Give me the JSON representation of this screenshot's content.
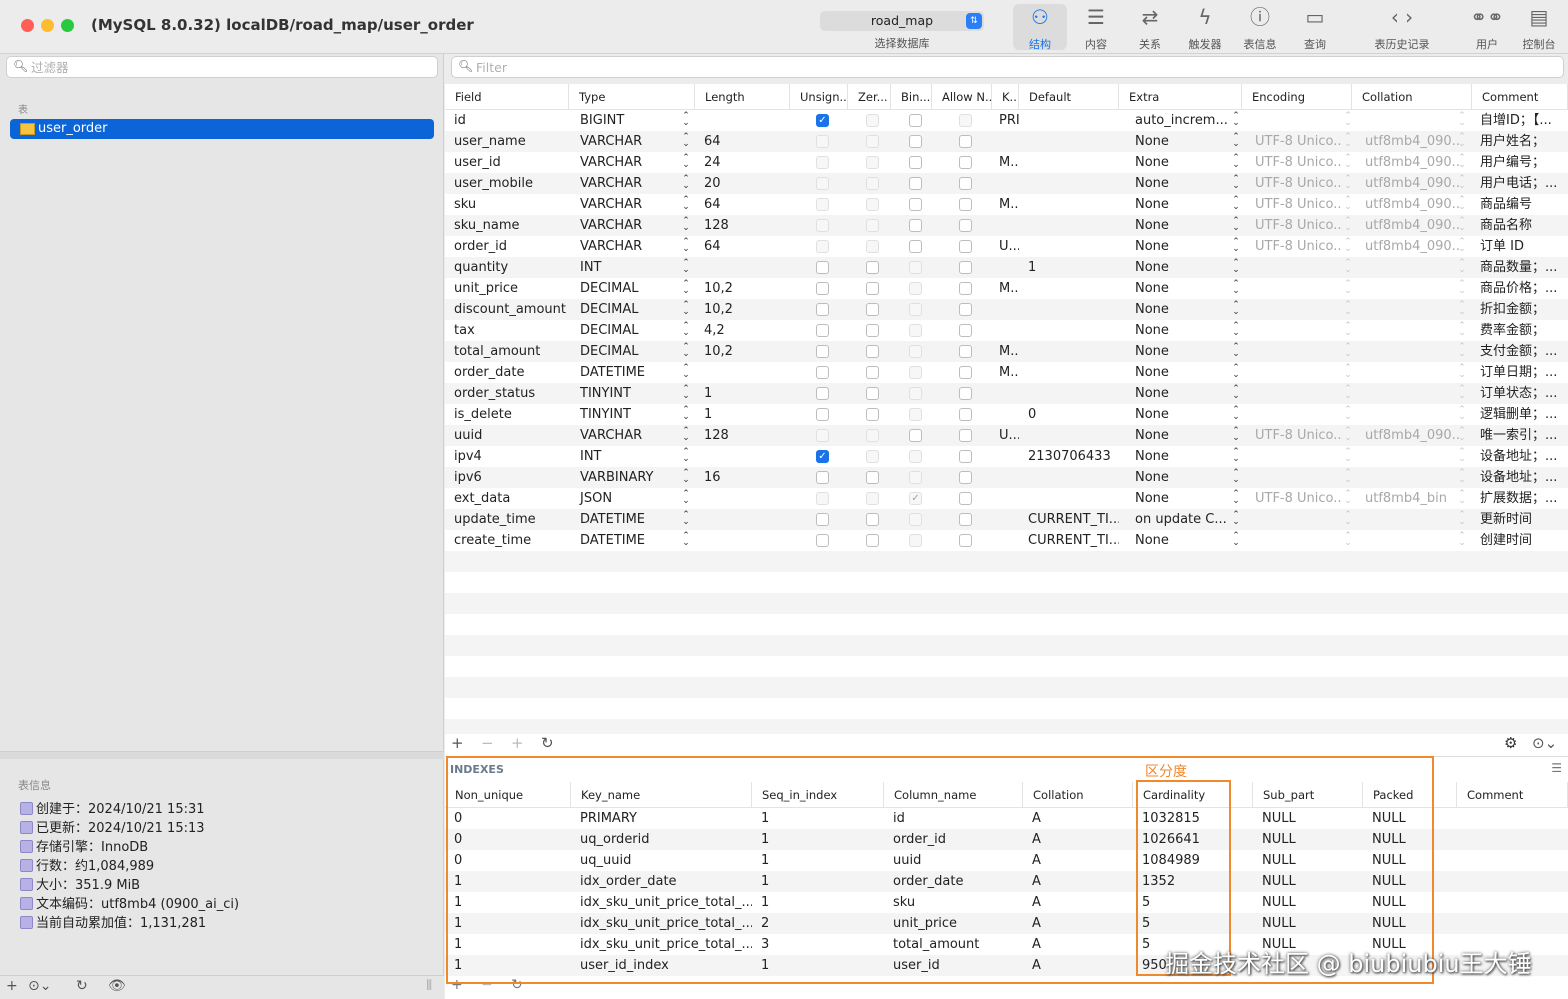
{
  "window": {
    "title": "(MySQL 8.0.32) localDB/road_map/user_order",
    "colors": {
      "close": "#ff5f57",
      "minimize": "#febc2e",
      "zoom": "#28c840",
      "accent": "#1a73e8",
      "highlight": "#f0882c"
    }
  },
  "toolbar": {
    "database": "road_map",
    "database_caption": "选择数据库",
    "buttons": [
      {
        "label": "结构",
        "icon": "structure-icon"
      },
      {
        "label": "内容",
        "icon": "list-icon"
      },
      {
        "label": "关系",
        "icon": "relations-icon"
      },
      {
        "label": "触发器",
        "icon": "bolt-icon"
      },
      {
        "label": "表信息",
        "icon": "info-icon"
      },
      {
        "label": "查询",
        "icon": "terminal-icon"
      },
      {
        "label": "表历史记录",
        "icon": "back-forward-icon"
      },
      {
        "label": "用户",
        "icon": "users-icon"
      },
      {
        "label": "控制台",
        "icon": "console-icon"
      }
    ]
  },
  "sidebar": {
    "filter_placeholder": "过滤器",
    "tables_heading": "表",
    "selected_table": "user_order",
    "info_heading": "表信息",
    "info": [
      "创建于：2024/10/21 15:31",
      "已更新：2024/10/21 15:13",
      "存储引擎：InnoDB",
      "行数：约1,084,989",
      "大小：351.9 MiB",
      "文本编码：utf8mb4 (0900_ai_ci)",
      "当前自动累加值：1,131,281"
    ]
  },
  "structure": {
    "filter_placeholder": "Filter",
    "columns": [
      "Field",
      "Type",
      "Length",
      "Unsign...",
      "Zer...",
      "Bin...",
      "Allow N...",
      "K...",
      "Default",
      "Extra",
      "Encoding",
      "Collation",
      "Comment"
    ],
    "rows": [
      {
        "field": "id",
        "type": "BIGINT",
        "length": "",
        "unsigned": true,
        "key": "PRI",
        "default": "",
        "extra": "auto_increm...",
        "encoding": "",
        "collation": "",
        "comment": "自增ID；【..."
      },
      {
        "field": "user_name",
        "type": "VARCHAR",
        "length": "64",
        "unsigned": false,
        "key": "",
        "default": "",
        "extra": "None",
        "encoding": "UTF-8 Unico...",
        "collation": "utf8mb4_090...",
        "comment": "用户姓名；"
      },
      {
        "field": "user_id",
        "type": "VARCHAR",
        "length": "24",
        "unsigned": false,
        "key": "M...",
        "default": "",
        "extra": "None",
        "encoding": "UTF-8 Unico...",
        "collation": "utf8mb4_090...",
        "comment": "用户编号；"
      },
      {
        "field": "user_mobile",
        "type": "VARCHAR",
        "length": "20",
        "unsigned": false,
        "key": "",
        "default": "",
        "extra": "None",
        "encoding": "UTF-8 Unico...",
        "collation": "utf8mb4_090...",
        "comment": "用户电话；..."
      },
      {
        "field": "sku",
        "type": "VARCHAR",
        "length": "64",
        "unsigned": false,
        "key": "M...",
        "default": "",
        "extra": "None",
        "encoding": "UTF-8 Unico...",
        "collation": "utf8mb4_090...",
        "comment": "商品编号"
      },
      {
        "field": "sku_name",
        "type": "VARCHAR",
        "length": "128",
        "unsigned": false,
        "key": "",
        "default": "",
        "extra": "None",
        "encoding": "UTF-8 Unico...",
        "collation": "utf8mb4_090...",
        "comment": "商品名称"
      },
      {
        "field": "order_id",
        "type": "VARCHAR",
        "length": "64",
        "unsigned": false,
        "key": "U...",
        "default": "",
        "extra": "None",
        "encoding": "UTF-8 Unico...",
        "collation": "utf8mb4_090...",
        "comment": "订单 ID"
      },
      {
        "field": "quantity",
        "type": "INT",
        "length": "",
        "unsigned": false,
        "key": "",
        "default": "1",
        "extra": "None",
        "encoding": "",
        "collation": "",
        "comment": "商品数量；..."
      },
      {
        "field": "unit_price",
        "type": "DECIMAL",
        "length": "10,2",
        "unsigned": false,
        "key": "M...",
        "default": "",
        "extra": "None",
        "encoding": "",
        "collation": "",
        "comment": "商品价格；..."
      },
      {
        "field": "discount_amount",
        "type": "DECIMAL",
        "length": "10,2",
        "unsigned": false,
        "key": "",
        "default": "",
        "extra": "None",
        "encoding": "",
        "collation": "",
        "comment": "折扣金额；"
      },
      {
        "field": "tax",
        "type": "DECIMAL",
        "length": "4,2",
        "unsigned": false,
        "key": "",
        "default": "",
        "extra": "None",
        "encoding": "",
        "collation": "",
        "comment": "费率金额；"
      },
      {
        "field": "total_amount",
        "type": "DECIMAL",
        "length": "10,2",
        "unsigned": false,
        "key": "M...",
        "default": "",
        "extra": "None",
        "encoding": "",
        "collation": "",
        "comment": "支付金额；..."
      },
      {
        "field": "order_date",
        "type": "DATETIME",
        "length": "",
        "unsigned": false,
        "key": "M...",
        "default": "",
        "extra": "None",
        "encoding": "",
        "collation": "",
        "comment": "订单日期；..."
      },
      {
        "field": "order_status",
        "type": "TINYINT",
        "length": "1",
        "unsigned": false,
        "key": "",
        "default": "",
        "extra": "None",
        "encoding": "",
        "collation": "",
        "comment": "订单状态；..."
      },
      {
        "field": "is_delete",
        "type": "TINYINT",
        "length": "1",
        "unsigned": false,
        "key": "",
        "default": "0",
        "extra": "None",
        "encoding": "",
        "collation": "",
        "comment": "逻辑删单；..."
      },
      {
        "field": "uuid",
        "type": "VARCHAR",
        "length": "128",
        "unsigned": false,
        "key": "U...",
        "default": "",
        "extra": "None",
        "encoding": "UTF-8 Unico...",
        "collation": "utf8mb4_090...",
        "comment": "唯一索引；..."
      },
      {
        "field": "ipv4",
        "type": "INT",
        "length": "",
        "unsigned": true,
        "key": "",
        "default": "2130706433",
        "extra": "None",
        "encoding": "",
        "collation": "",
        "comment": "设备地址；..."
      },
      {
        "field": "ipv6",
        "type": "VARBINARY",
        "length": "16",
        "unsigned": false,
        "key": "",
        "default": "",
        "extra": "None",
        "encoding": "",
        "collation": "",
        "comment": "设备地址；..."
      },
      {
        "field": "ext_data",
        "type": "JSON",
        "length": "",
        "unsigned": false,
        "key": "",
        "default": "",
        "extra": "None",
        "encoding": "UTF-8 Unico...",
        "collation": "utf8mb4_bin",
        "comment": "扩展数据；..."
      },
      {
        "field": "update_time",
        "type": "DATETIME",
        "length": "",
        "unsigned": false,
        "key": "",
        "default": "CURRENT_TI...",
        "extra": "on update C...",
        "encoding": "",
        "collation": "",
        "comment": "更新时间"
      },
      {
        "field": "create_time",
        "type": "DATETIME",
        "length": "",
        "unsigned": false,
        "key": "",
        "default": "CURRENT_TI...",
        "extra": "None",
        "encoding": "",
        "collation": "",
        "comment": "创建时间"
      }
    ]
  },
  "indexes": {
    "title": "INDEXES",
    "annotation": "区分度",
    "columns": [
      "Non_unique",
      "Key_name",
      "Seq_in_index",
      "Column_name",
      "Collation",
      "Cardinality",
      "Sub_part",
      "Packed",
      "Comment"
    ],
    "rows": [
      [
        "0",
        "PRIMARY",
        "1",
        "id",
        "A",
        "1032815",
        "NULL",
        "NULL",
        ""
      ],
      [
        "0",
        "uq_orderid",
        "1",
        "order_id",
        "A",
        "1026641",
        "NULL",
        "NULL",
        ""
      ],
      [
        "0",
        "uq_uuid",
        "1",
        "uuid",
        "A",
        "1084989",
        "NULL",
        "NULL",
        ""
      ],
      [
        "1",
        "idx_order_date",
        "1",
        "order_date",
        "A",
        "1352",
        "NULL",
        "NULL",
        ""
      ],
      [
        "1",
        "idx_sku_unit_price_total_...",
        "1",
        "sku",
        "A",
        "5",
        "NULL",
        "NULL",
        ""
      ],
      [
        "1",
        "idx_sku_unit_price_total_...",
        "2",
        "unit_price",
        "A",
        "5",
        "NULL",
        "NULL",
        ""
      ],
      [
        "1",
        "idx_sku_unit_price_total_...",
        "3",
        "total_amount",
        "A",
        "5",
        "NULL",
        "NULL",
        ""
      ],
      [
        "1",
        "user_id_index",
        "1",
        "user_id",
        "A",
        "950",
        "",
        "",
        ""
      ]
    ]
  },
  "watermark": "掘金技术社区 @ biubiubiu王大锤"
}
